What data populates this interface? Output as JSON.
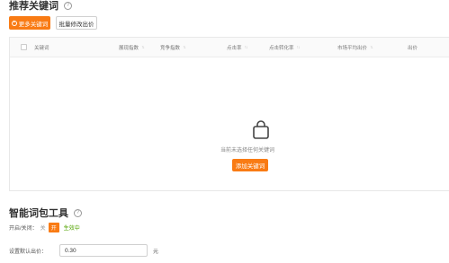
{
  "recommend": {
    "title": "推荐关键词",
    "more_btn": "更多关键词",
    "batch_btn": "批量修改出价"
  },
  "table": {
    "columns": [
      {
        "label": "关键词",
        "sortable": false
      },
      {
        "label": "展现指数",
        "sortable": true
      },
      {
        "label": "竞争指数",
        "sortable": true
      },
      {
        "label": "点击率",
        "sortable": true
      },
      {
        "label": "点击转化率",
        "sortable": true
      },
      {
        "label": "市场平均出价",
        "sortable": true
      },
      {
        "label": "出价",
        "sortable": false
      }
    ],
    "sort_glyph": "↑↓",
    "empty_text": "当前未选择任何关键词",
    "add_btn": "添加关键词"
  },
  "smart": {
    "title": "智能词包工具",
    "switch_label": "开启/关闭：",
    "off_label": "关",
    "on_label": "开",
    "status": "生效中",
    "default_bid_label": "设置默认出价：",
    "default_bid_value": "0.30",
    "unit": "元"
  },
  "colors": {
    "accent": "#f97b14",
    "status_green": "#52a300"
  }
}
